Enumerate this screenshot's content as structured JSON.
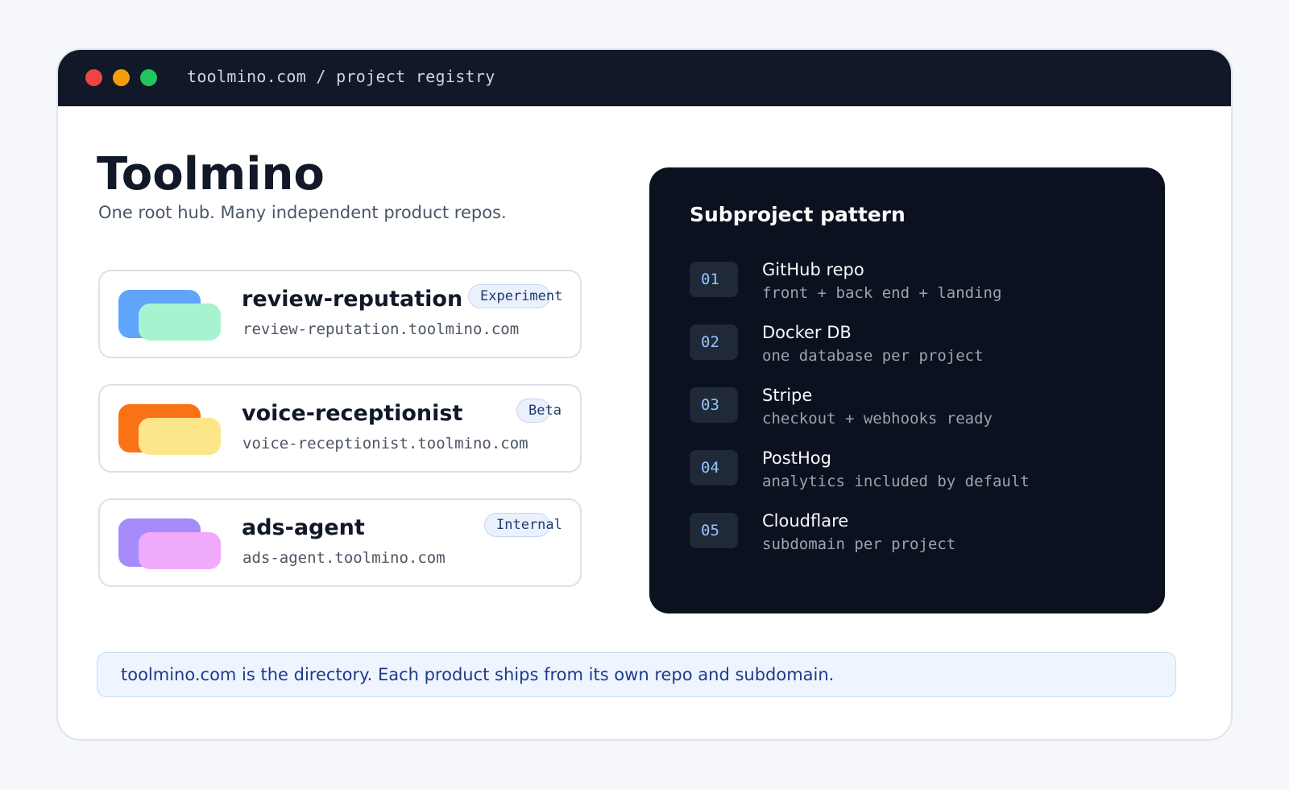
{
  "window": {
    "url": "toolmino.com / project registry",
    "controls": {
      "close_color": "#ef4444",
      "minimize_color": "#f59e0b",
      "maximize_color": "#22c55e"
    }
  },
  "hero": {
    "title": "Toolmino",
    "subtitle": "One root hub. Many independent product repos."
  },
  "projects": [
    {
      "name": "review-reputation",
      "domain": "review-reputation.toolmino.com",
      "badge": "Experiment",
      "colors": {
        "back": "#60a5fa",
        "front": "#a7f3d0"
      }
    },
    {
      "name": "voice-receptionist",
      "domain": "voice-receptionist.toolmino.com",
      "badge": "Beta",
      "colors": {
        "back": "#f97316",
        "front": "#fde68a"
      }
    },
    {
      "name": "ads-agent",
      "domain": "ads-agent.toolmino.com",
      "badge": "Internal",
      "colors": {
        "back": "#a78bfa",
        "front": "#f0abfc"
      }
    }
  ],
  "pattern": {
    "title": "Subproject pattern",
    "steps": [
      {
        "num": "01",
        "title": "GitHub repo",
        "desc": "front + back end + landing"
      },
      {
        "num": "02",
        "title": "Docker DB",
        "desc": "one database per project"
      },
      {
        "num": "03",
        "title": "Stripe",
        "desc": "checkout + webhooks ready"
      },
      {
        "num": "04",
        "title": "PostHog",
        "desc": "analytics included by default"
      },
      {
        "num": "05",
        "title": "Cloudflare",
        "desc": "subdomain per project"
      }
    ]
  },
  "footer": {
    "note": "toolmino.com is the directory. Each product ships from its own repo and subdomain."
  }
}
